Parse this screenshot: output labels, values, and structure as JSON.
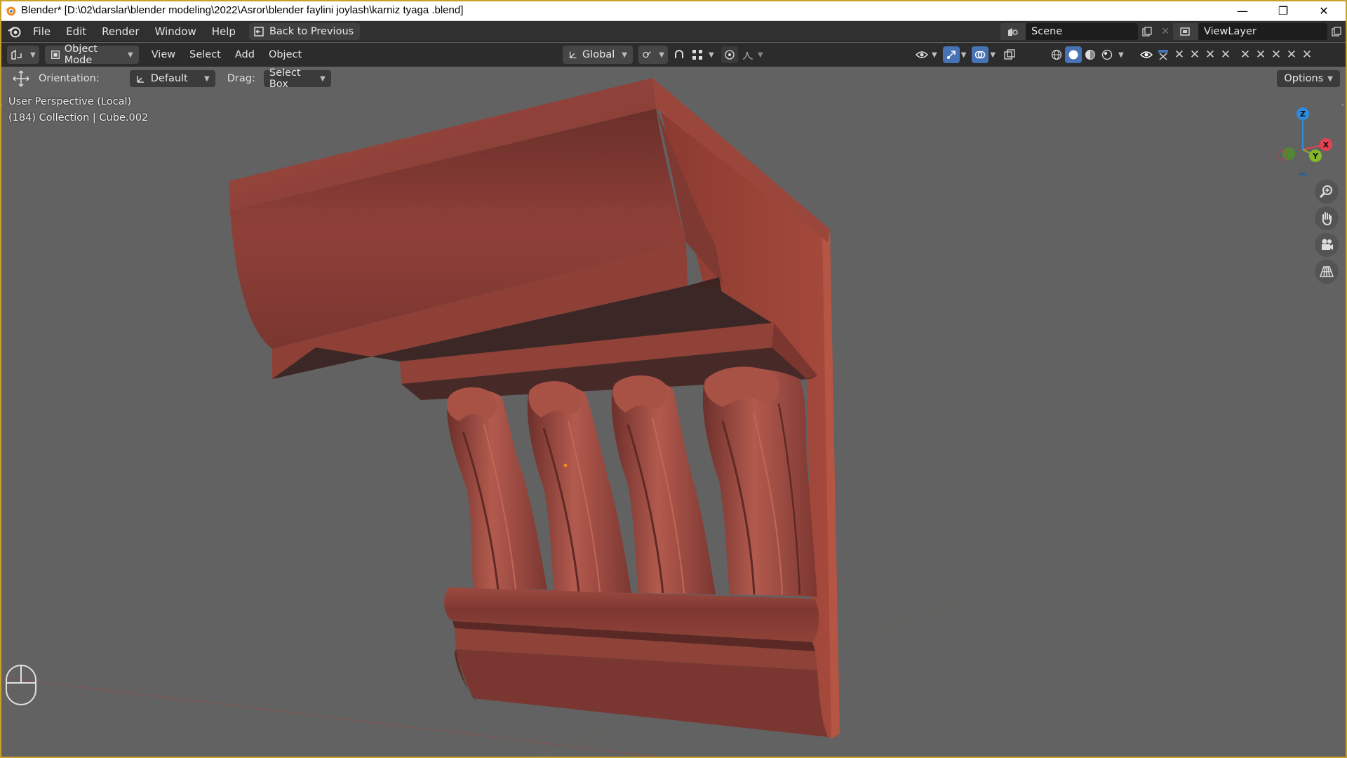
{
  "window": {
    "title": "Blender* [D:\\02\\darslar\\blender modeling\\2022\\Asror\\blender faylini joylash\\karniz tyaga .blend]",
    "minimize_symbol": "—",
    "restore_symbol": "❐",
    "close_symbol": "✕"
  },
  "topbar": {
    "menus": [
      "File",
      "Edit",
      "Render",
      "Window",
      "Help"
    ],
    "back_button": "Back to Previous",
    "scene": "Scene",
    "view_layer": "ViewLayer"
  },
  "header": {
    "mode": "Object Mode",
    "menus": [
      "View",
      "Select",
      "Add",
      "Object"
    ],
    "transform_orientation": "Global"
  },
  "tool_settings": {
    "orientation_label": "Orientation:",
    "orientation_value": "Default",
    "drag_label": "Drag:",
    "drag_value": "Select Box",
    "options": "Options"
  },
  "viewport": {
    "perspective": "User Perspective (Local)",
    "collection_info": "(184) Collection | Cube.002",
    "gizmo_axes": {
      "x": "X",
      "y": "Y",
      "z": "Z"
    },
    "object_color": "#8a3a33"
  },
  "colors": {
    "accent": "#4772b3",
    "axis_x": "#e8404f",
    "axis_y": "#83b82a",
    "axis_z": "#2d8ce0",
    "border": "#c9a227"
  }
}
